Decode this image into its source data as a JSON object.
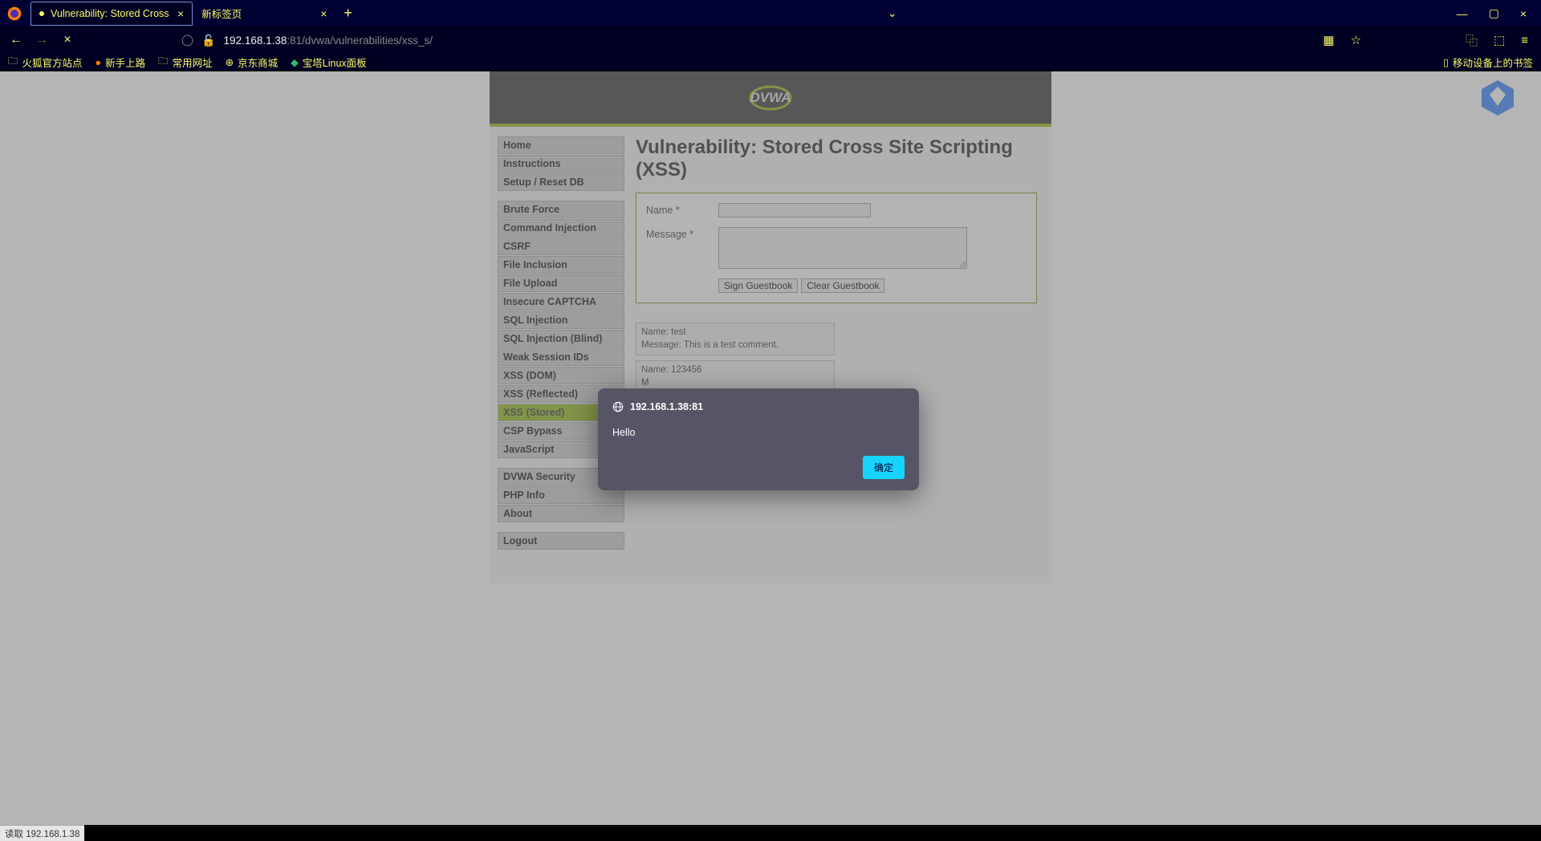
{
  "browser": {
    "tabs": [
      {
        "title": "Vulnerability: Stored Cross Sit",
        "active": true,
        "loading": true
      },
      {
        "title": "新标签页",
        "active": false,
        "loading": false
      }
    ],
    "url_host": "192.168.1.38",
    "url_port": ":81",
    "url_path": "/dvwa/vulnerabilities/xss_s/",
    "bookmarks": [
      "火狐官方站点",
      "新手上路",
      "常用网址",
      "京东商城",
      "宝塔Linux面板"
    ],
    "bookmark_mobile": "移动设备上的书签",
    "status_text": "读取 192.168.1.38"
  },
  "page": {
    "heading": "Vulnerability: Stored Cross Site Scripting (XSS)",
    "sidebar_groups": [
      [
        "Home",
        "Instructions",
        "Setup / Reset DB"
      ],
      [
        "Brute Force",
        "Command Injection",
        "CSRF",
        "File Inclusion",
        "File Upload",
        "Insecure CAPTCHA",
        "SQL Injection",
        "SQL Injection (Blind)",
        "Weak Session IDs",
        "XSS (DOM)",
        "XSS (Reflected)",
        "XSS (Stored)",
        "CSP Bypass",
        "JavaScript"
      ],
      [
        "DVWA Security",
        "PHP Info",
        "About"
      ],
      [
        "Logout"
      ]
    ],
    "active_sidebar": "XSS (Stored)",
    "form": {
      "name_label": "Name *",
      "message_label": "Message *",
      "sign_btn": "Sign Guestbook",
      "clear_btn": "Clear Guestbook"
    },
    "entries": [
      {
        "name_line": "Name: test",
        "msg_line": "Message: This is a test comment."
      },
      {
        "name_line": "Name: 123456",
        "msg_line": "M"
      }
    ]
  },
  "alert": {
    "origin": "192.168.1.38:81",
    "message": "Hello",
    "ok": "确定"
  }
}
